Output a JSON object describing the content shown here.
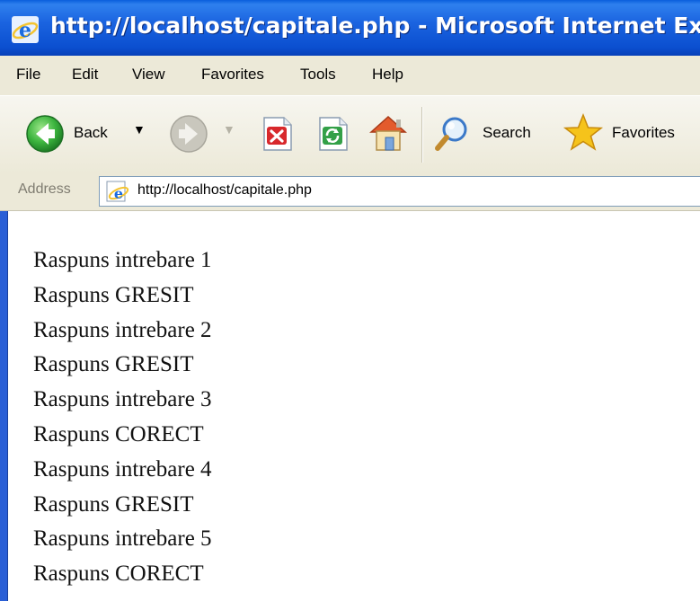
{
  "window": {
    "title": "http://localhost/capitale.php - Microsoft Internet Explorer"
  },
  "menu": {
    "items": [
      "File",
      "Edit",
      "View",
      "Favorites",
      "Tools",
      "Help"
    ]
  },
  "toolbar": {
    "back_label": "Back",
    "search_label": "Search",
    "favorites_label": "Favorites"
  },
  "address": {
    "label": "Address",
    "url": "http://localhost/capitale.php"
  },
  "content": {
    "lines": [
      "Raspuns intrebare 1",
      "Raspuns GRESIT",
      "Raspuns intrebare 2",
      "Raspuns GRESIT",
      "Raspuns intrebare 3",
      "Raspuns CORECT",
      "Raspuns intrebare 4",
      "Raspuns GRESIT",
      "Raspuns intrebare 5",
      "Raspuns CORECT"
    ]
  },
  "icons": {
    "app": "internet-explorer-icon",
    "back": "back-arrow-icon",
    "forward": "forward-arrow-icon",
    "stop": "stop-icon",
    "refresh": "refresh-icon",
    "home": "home-icon",
    "search": "search-icon",
    "favorites": "favorites-star-icon",
    "page": "page-icon"
  },
  "colors": {
    "titlebar": "#0b4fd0",
    "chrome": "#ece9d8",
    "back_green": "#2fa83a",
    "stop_red": "#d8282c",
    "refresh_green": "#33a048",
    "star_yellow": "#f5c31b"
  }
}
